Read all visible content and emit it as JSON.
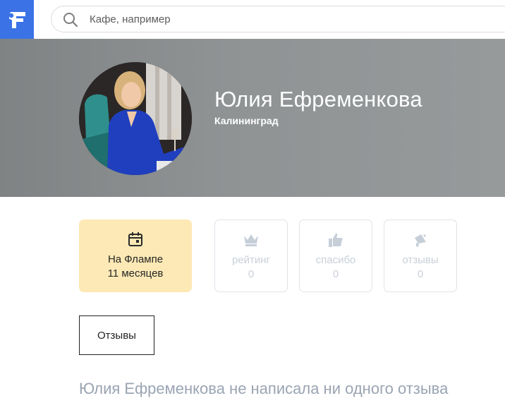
{
  "app": {
    "logo_icon": "flamp-logo-icon",
    "accent": "#3b73e6"
  },
  "search": {
    "placeholder": "Кафе, например",
    "value": ""
  },
  "profile": {
    "name": "Юлия Ефременкова",
    "city": "Калининград",
    "avatar": "user-avatar-photo"
  },
  "stats": {
    "on_flamp": {
      "icon": "calendar-icon",
      "label": "На Флампе",
      "value": "11 месяцев",
      "color": "#fde9b5"
    },
    "rating": {
      "icon": "crown-icon",
      "label": "рейтинг",
      "value": "0"
    },
    "thanks": {
      "icon": "thumbs-up-icon",
      "label": "спасибо",
      "value": "0"
    },
    "reviews": {
      "icon": "megaphone-icon",
      "label": "отзывы",
      "value": "0"
    }
  },
  "tabs": {
    "reviews_label": "Отзывы"
  },
  "empty_message": "Юлия Ефременкова не написала ни одного отзыва"
}
